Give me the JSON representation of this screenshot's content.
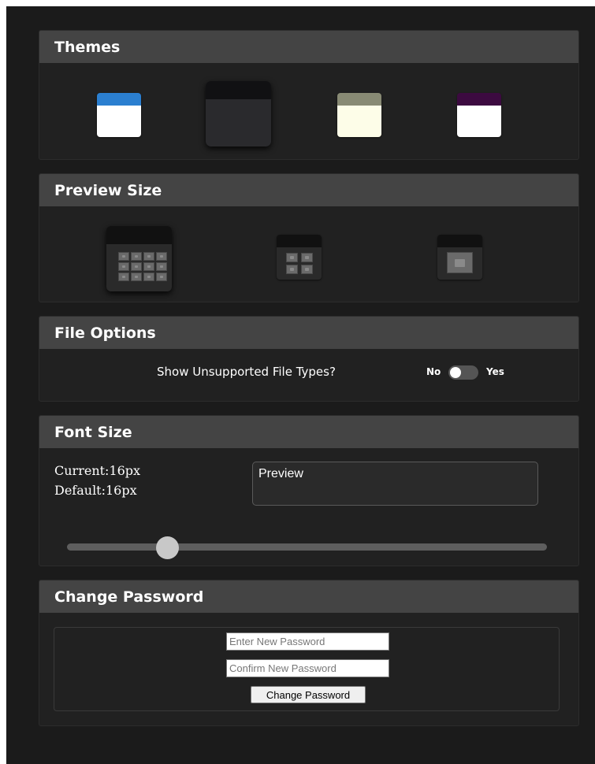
{
  "themes": {
    "title": "Themes",
    "options": [
      {
        "name": "blue",
        "top_color": "#2b7fd0",
        "bottom_color": "#ffffff",
        "selected": false
      },
      {
        "name": "dark",
        "top_color": "#111113",
        "bottom_color": "#2a2a2d",
        "selected": true
      },
      {
        "name": "olive",
        "top_color": "#888a74",
        "bottom_color": "#fdfde8",
        "selected": false
      },
      {
        "name": "purple",
        "top_color": "#3c0a40",
        "bottom_color": "#ffffff",
        "selected": false
      }
    ]
  },
  "preview_size": {
    "title": "Preview Size",
    "options": [
      {
        "name": "small-thumbnails",
        "grid": "4x3",
        "selected": true
      },
      {
        "name": "medium-thumbnails",
        "grid": "2x2",
        "selected": false
      },
      {
        "name": "large-thumbnail",
        "grid": "1x1",
        "selected": false
      }
    ]
  },
  "file_options": {
    "title": "File Options",
    "question": "Show Unsupported File Types?",
    "no_label": "No",
    "yes_label": "Yes",
    "enabled": false
  },
  "font_size": {
    "title": "Font Size",
    "current_label": "Current:16px",
    "default_label": "Default:16px",
    "preview_text": "Preview",
    "slider_fraction": 0.21
  },
  "change_password": {
    "title": "Change Password",
    "new_placeholder": "Enter New Password",
    "confirm_placeholder": "Confirm New Password",
    "button_label": "Change Password"
  },
  "colors": {
    "page_bg": "#1b1b1b",
    "panel_bg": "#212121",
    "header_bg": "#444444"
  }
}
